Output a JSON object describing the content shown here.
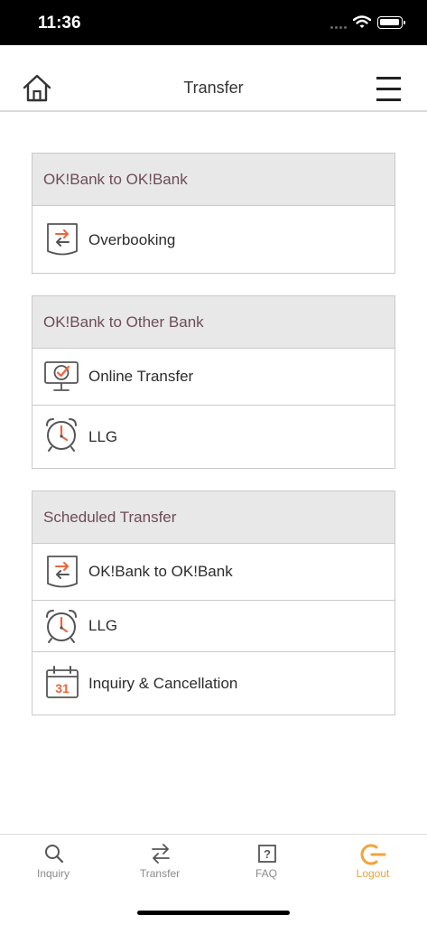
{
  "status_bar": {
    "time": "11:36"
  },
  "header": {
    "title": "Transfer"
  },
  "sections": [
    {
      "title": "OK!Bank to OK!Bank",
      "items": [
        {
          "label": "Overbooking",
          "icon": "transfer-doc-icon"
        }
      ]
    },
    {
      "title": "OK!Bank to Other Bank",
      "items": [
        {
          "label": "Online Transfer",
          "icon": "monitor-check-icon"
        },
        {
          "label": "LLG",
          "icon": "alarm-clock-icon"
        }
      ]
    },
    {
      "title": "Scheduled Transfer",
      "items": [
        {
          "label": "OK!Bank to OK!Bank",
          "icon": "transfer-doc-icon"
        },
        {
          "label": "LLG",
          "icon": "alarm-clock-icon"
        },
        {
          "label": "Inquiry & Cancellation",
          "icon": "calendar-icon",
          "calendar_day": "31"
        }
      ]
    }
  ],
  "tabbar": {
    "items": [
      {
        "label": "Inquiry",
        "icon": "search-icon"
      },
      {
        "label": "Transfer",
        "icon": "transfer-arrows-icon"
      },
      {
        "label": "FAQ",
        "icon": "help-icon",
        "glyph": "?"
      },
      {
        "label": "Logout",
        "icon": "power-icon"
      }
    ]
  },
  "colors": {
    "accent": "#f0643c",
    "logout": "#e8a33b",
    "section_header_bg": "#e8e8e8",
    "section_title": "#6d4c55"
  }
}
